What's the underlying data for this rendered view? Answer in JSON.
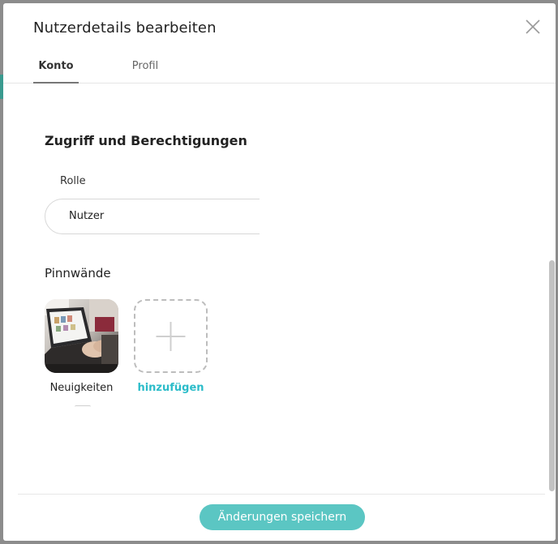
{
  "modal": {
    "title": "Nutzerdetails bearbeiten",
    "close_icon": "close-icon"
  },
  "tabs": [
    {
      "label": "Konto",
      "active": true
    },
    {
      "label": "Profil",
      "active": false
    }
  ],
  "access": {
    "section_title": "Zugriff und Berechtigungen",
    "role_label": "Rolle",
    "role_value": "Nutzer"
  },
  "boards": {
    "section_title": "Pinnwände",
    "items": [
      {
        "label": "Neuigkeiten",
        "image": "laptop-photo"
      }
    ],
    "add_label": "hinzufügen",
    "add_icon": "plus-icon"
  },
  "footer": {
    "save_label": "Änderungen speichern"
  },
  "colors": {
    "accent": "#5bc6c3",
    "link": "#2bbcc9",
    "overlay": "#8c8c8c"
  }
}
